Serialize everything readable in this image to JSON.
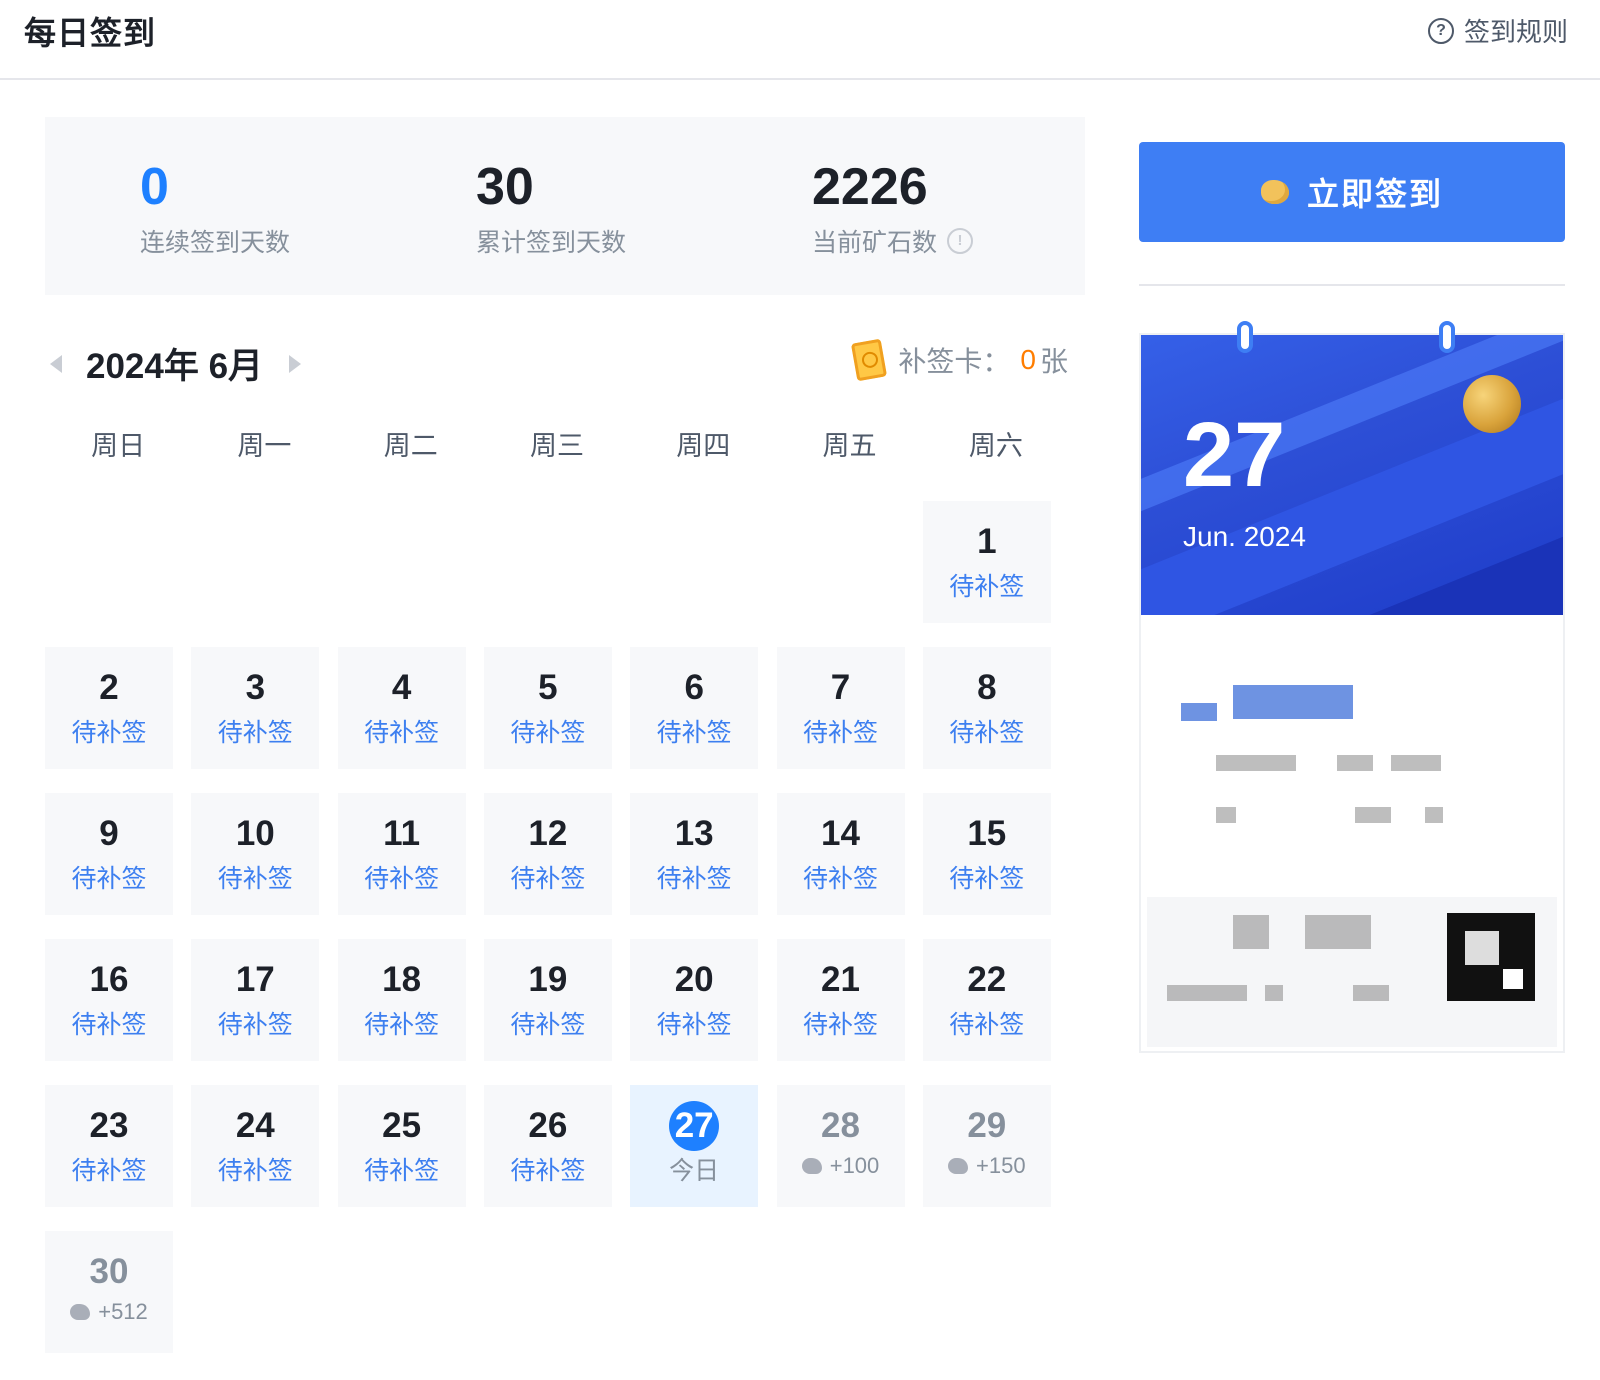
{
  "header": {
    "title": "每日签到",
    "rules_label": "签到规则",
    "rules_icon": "question-circle-icon"
  },
  "stats": [
    {
      "value": "0",
      "label": "连续签到天数",
      "color": "#1e80ff"
    },
    {
      "value": "30",
      "label": "累计签到天数",
      "color": "#1d2129"
    },
    {
      "value": "2226",
      "label": "当前矿石数",
      "color": "#1d2129"
    }
  ],
  "calendar": {
    "month_label": "2024年 6月",
    "card_label": "补签卡：",
    "card_count": "0",
    "card_unit": "张",
    "weekdays": [
      "周日",
      "周一",
      "周二",
      "周三",
      "周四",
      "周五",
      "周六"
    ],
    "days": [
      {
        "d": "1",
        "s": "待补签"
      },
      {
        "d": "2",
        "s": "待补签"
      },
      {
        "d": "3",
        "s": "待补签"
      },
      {
        "d": "4",
        "s": "待补签"
      },
      {
        "d": "5",
        "s": "待补签"
      },
      {
        "d": "6",
        "s": "待补签"
      },
      {
        "d": "7",
        "s": "待补签"
      },
      {
        "d": "8",
        "s": "待补签"
      },
      {
        "d": "9",
        "s": "待补签"
      },
      {
        "d": "10",
        "s": "待补签"
      },
      {
        "d": "11",
        "s": "待补签"
      },
      {
        "d": "12",
        "s": "待补签"
      },
      {
        "d": "13",
        "s": "待补签"
      },
      {
        "d": "14",
        "s": "待补签"
      },
      {
        "d": "15",
        "s": "待补签"
      },
      {
        "d": "16",
        "s": "待补签"
      },
      {
        "d": "17",
        "s": "待补签"
      },
      {
        "d": "18",
        "s": "待补签"
      },
      {
        "d": "19",
        "s": "待补签"
      },
      {
        "d": "20",
        "s": "待补签"
      },
      {
        "d": "21",
        "s": "待补签"
      },
      {
        "d": "22",
        "s": "待补签"
      },
      {
        "d": "23",
        "s": "待补签"
      },
      {
        "d": "24",
        "s": "待补签"
      },
      {
        "d": "25",
        "s": "待补签"
      },
      {
        "d": "26",
        "s": "待补签"
      },
      {
        "d": "27",
        "s": "今日"
      },
      {
        "d": "28",
        "s": "+100"
      },
      {
        "d": "29",
        "s": "+150"
      },
      {
        "d": "30",
        "s": "+512"
      }
    ]
  },
  "signin_button": "立即签到",
  "date_card": {
    "day": "27",
    "month": "Jun. 2024"
  }
}
